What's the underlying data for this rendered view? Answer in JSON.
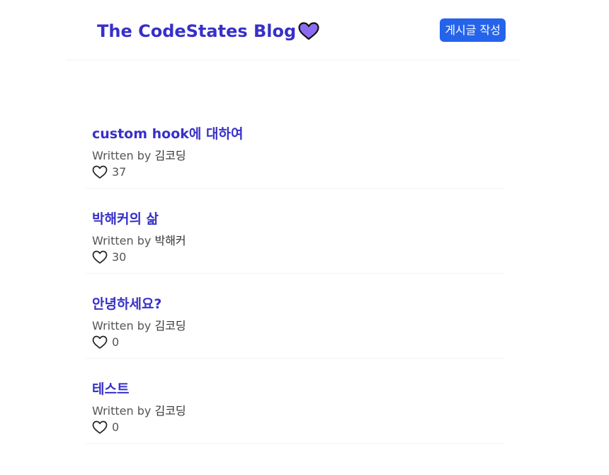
{
  "header": {
    "title": "The CodeStates Blog",
    "logo_icon": "purple-heart-icon",
    "write_button_label": "게시글 작성"
  },
  "posts": [
    {
      "title": "custom hook에 대하여",
      "written_by": "Written by",
      "author": "김코딩",
      "likes": "37",
      "like_icon": "heart-outline-icon"
    },
    {
      "title": "박해커의 삶",
      "written_by": "Written by",
      "author": "박해커",
      "likes": "30",
      "like_icon": "heart-outline-icon"
    },
    {
      "title": "안녕하세요?",
      "written_by": "Written by",
      "author": "김코딩",
      "likes": "0",
      "like_icon": "heart-outline-icon"
    },
    {
      "title": "테스트",
      "written_by": "Written by",
      "author": "김코딩",
      "likes": "0",
      "like_icon": "heart-outline-icon"
    }
  ],
  "colors": {
    "brand": "#3730c8",
    "button": "#2563eb",
    "heart_fill": "#8b6cf0"
  }
}
